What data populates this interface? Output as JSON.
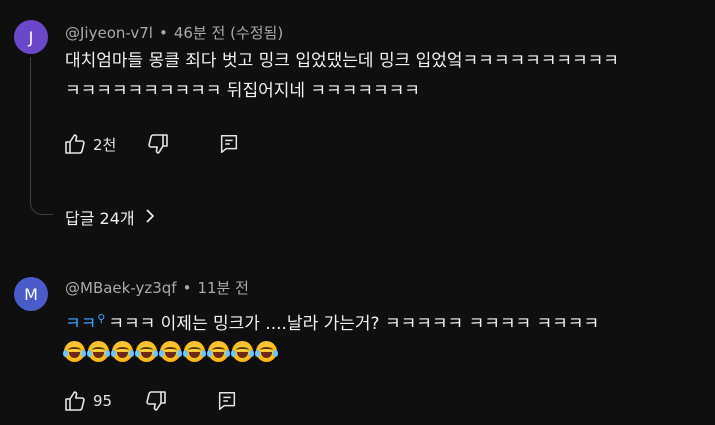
{
  "colors": {
    "background": "#0f0f0f",
    "avatar_j": "#6b48c9",
    "avatar_m": "#4a5cc9",
    "link_blue": "#3ea6ff"
  },
  "comments": [
    {
      "avatar_letter": "J",
      "handle": "@Jiyeon-v7l",
      "separator": "•",
      "time": "46분 전 (수정됨)",
      "lines": [
        "대치엄마들 몽클 죄다 벗고 밍크 입었댔는데 밍크 입었엌ㅋㅋㅋㅋㅋㅋㅋㅋㅋㅋ",
        "ㅋㅋㅋㅋㅋㅋㅋㅋㅋㅋ 뒤집어지네 ㅋㅋㅋㅋㅋㅋㅋ"
      ],
      "likes": "2천",
      "icons": [
        "thumbs-up-icon",
        "thumbs-down-icon",
        "reply-icon"
      ],
      "replies_label": "답글 24개"
    },
    {
      "avatar_letter": "M",
      "handle": "@MBaek-yz3qf",
      "separator": "•",
      "time": "11분 전",
      "text_lead": "ㅋㅋ",
      "text_rest": "ㅋㅋㅋ 이제는  밍크가 ....날라 가는거?  ㅋㅋㅋㅋㅋ ㅋㅋㅋㅋ ㅋㅋㅋㅋ",
      "emoji_icon": "laughing-tears-emoji",
      "emoji_count": 9,
      "likes": "95",
      "icons": [
        "thumbs-up-icon",
        "thumbs-down-icon",
        "reply-icon"
      ]
    }
  ]
}
